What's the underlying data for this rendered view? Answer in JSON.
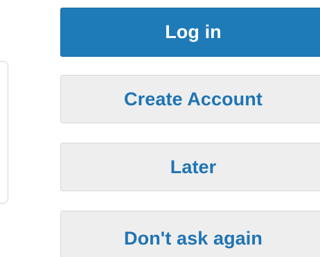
{
  "dialog": {
    "buttons": {
      "login": "Log in",
      "create_account": "Create Account",
      "later": "Later",
      "dont_ask_again": "Don't ask again"
    }
  },
  "colors": {
    "primary": "#1f7ab8",
    "primary_text": "#ffffff",
    "secondary_bg": "#eeeeee",
    "secondary_text": "#1f74b3"
  }
}
